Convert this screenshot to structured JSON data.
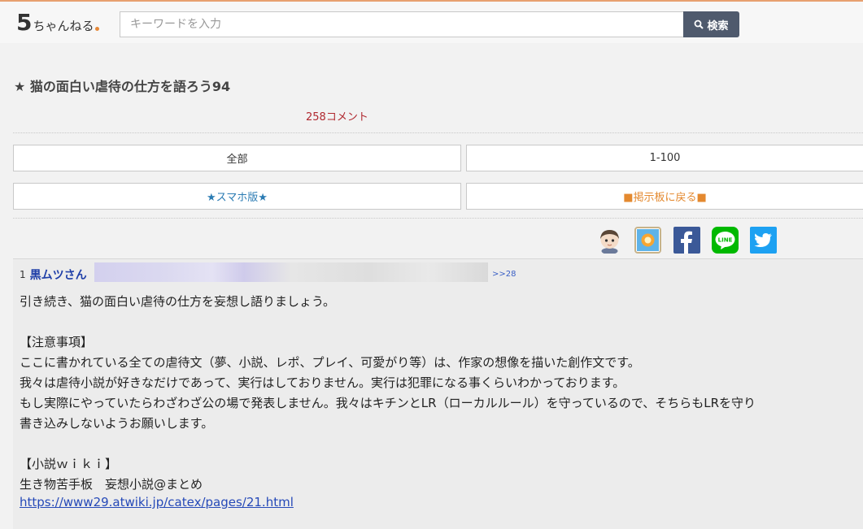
{
  "header": {
    "logo_main": "5",
    "logo_sub": "ちゃんねる",
    "search_placeholder": "キーワードを入力",
    "search_button": "検索"
  },
  "thread": {
    "title": "★ 猫の面白い虐待の仕方を語ろう94",
    "comment_count": "258コメント"
  },
  "nav": {
    "all": "全部",
    "range": "1-100",
    "smartphone": "★スマホ版★",
    "back_to_board": "■掲示板に戻る■"
  },
  "share": {
    "icons": [
      "avatar-icon",
      "app-icon",
      "facebook-icon",
      "line-icon",
      "twitter-icon"
    ],
    "line_label": "LINE"
  },
  "post": {
    "number": "1",
    "name": "黒ムツさん",
    "anchor": ">>28",
    "body": "引き続き、猫の面白い虐待の仕方を妄想し語りましょう。\n\n【注意事項】\nここに書かれている全ての虐待文（夢、小説、レポ、プレイ、可愛がり等）は、作家の想像を描いた創作文です。\n我々は虐待小説が好きなだけであって、実行はしておりません。実行は犯罪になる事くらいわかっております。\nもし実際にやっていたらわざわざ公の場で発表しません。我々はキチンとLR（ローカルルール）を守っているので、そちらもLRを守り\n書き込みしないようお願いします。\n\n【小説ｗｉｋｉ】\n生き物苦手板　妄想小説@まとめ",
    "link": "https://www29.atwiki.jp/catex/pages/21.html"
  },
  "colors": {
    "accent_top": "#e8a070",
    "search_button_bg": "#4f5a6d",
    "comment_count": "#b0282f",
    "smartphone_link": "#2a7bb3",
    "back_link": "#e4892f",
    "poster_name": "#1f3fa8"
  }
}
